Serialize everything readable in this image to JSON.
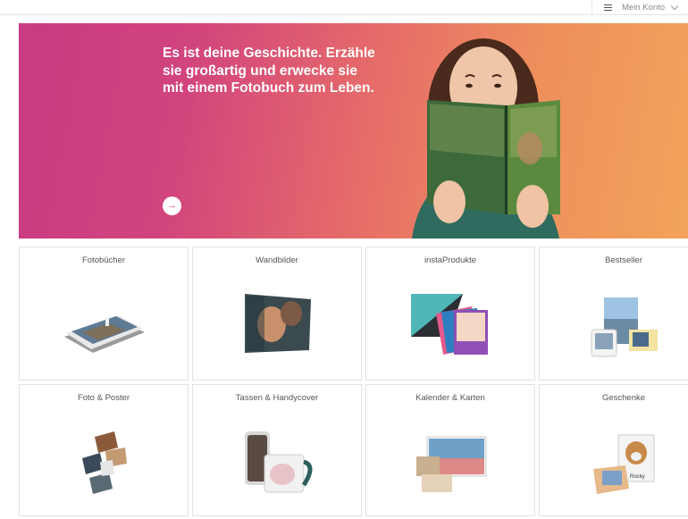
{
  "header": {
    "account_label": "Mein Konto"
  },
  "hero": {
    "headline": "Es ist deine Geschichte. Erzähle sie großartig und erwecke sie mit einem Fotobuch zum Leben.",
    "cta_arrow": "→"
  },
  "categories": [
    {
      "label": "Fotobücher"
    },
    {
      "label": "Wandbilder"
    },
    {
      "label": "instaProdukte"
    },
    {
      "label": "Bestseller"
    },
    {
      "label": "Foto & Poster"
    },
    {
      "label": "Tassen & Handycover"
    },
    {
      "label": "Kalender & Karten"
    },
    {
      "label": "Geschenke"
    }
  ],
  "product_art_text": {
    "dog_name": "Rocky"
  },
  "colors": {
    "hero_start": "#c93b83",
    "hero_end": "#f2a35a",
    "tile_border": "#e2e2e2"
  }
}
